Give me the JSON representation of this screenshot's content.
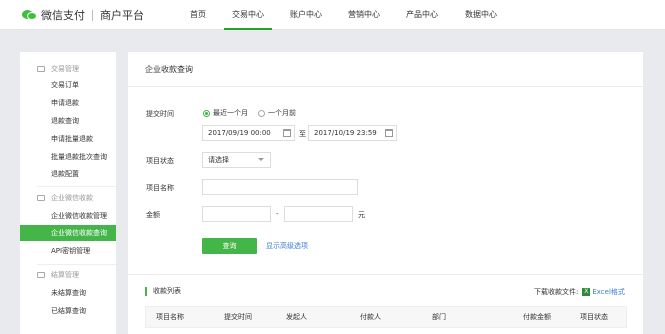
{
  "brand": {
    "name": "微信支付",
    "subtitle": "商户平台"
  },
  "nav": [
    {
      "label": "首页"
    },
    {
      "label": "交易中心"
    },
    {
      "label": "账户中心"
    },
    {
      "label": "营销中心"
    },
    {
      "label": "产品中心"
    },
    {
      "label": "数据中心"
    }
  ],
  "nav_active": "交易中心",
  "sidebar": {
    "groups": [
      {
        "title": "交易管理",
        "items": [
          "交易订单",
          "申请退款",
          "退款查询",
          "申请批量退款",
          "批量退款批次查询",
          "退款配置"
        ]
      },
      {
        "title": "企业微信收款",
        "items": [
          "企业微信收款管理",
          "企业微信收款查询",
          "API密钥管理"
        ]
      },
      {
        "title": "结算管理",
        "items": [
          "未结算查询",
          "已结算查询"
        ]
      }
    ],
    "active_item": "企业微信收款查询"
  },
  "main": {
    "title": "企业收款查询",
    "submit_time_label": "提交时间",
    "radio_recent_month": "最近一个月",
    "radio_month_ago": "一个月前",
    "start_date": "2017/09/19 00:00",
    "range_sep": "至",
    "end_date": "2017/10/19 23:59",
    "status_label": "项目状态",
    "status_value": "请选择",
    "project_name_label": "项目名称",
    "project_name_value": "",
    "amount_label": "金额",
    "amount_sep": "-",
    "amount_unit": "元",
    "query_button": "查询",
    "advanced_link": "显示高级选项",
    "list_title": "收款列表",
    "download_label": "下载收款文件:",
    "excel_link": "Excel格式",
    "excel_icon_text": "X",
    "table_headers": [
      "项目名称",
      "提交时间",
      "发起人",
      "付款人",
      "部门",
      "付款金额",
      "项目状态"
    ]
  },
  "colors": {
    "accent": "#44b549",
    "link": "#3a7bd5"
  },
  "icons": [
    "wechat-pay-logo-icon",
    "calendar-icon",
    "chevron-down-icon",
    "excel-icon",
    "group-icon"
  ]
}
